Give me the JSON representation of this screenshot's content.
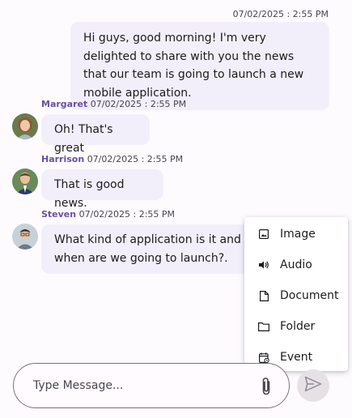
{
  "own_message": {
    "time": "07/02/2025 : 2:55 PM",
    "text": "Hi guys, good morning! I'm very delighted to share with you the news that our team is going to launch a new mobile application."
  },
  "messages": [
    {
      "author": "Margaret",
      "time": "07/02/2025 : 2:55 PM",
      "text": "Oh! That's great",
      "avatar_icon": "avatar-woman"
    },
    {
      "author": "Harrison",
      "time": "07/02/2025 : 2:55 PM",
      "text": "That is good news.",
      "avatar_icon": "avatar-man-suit"
    },
    {
      "author": "Steven",
      "time": "07/02/2025 : 2:55 PM",
      "text": "What kind of application is it and when are we going to launch?.",
      "avatar_icon": "avatar-man-glasses"
    }
  ],
  "attach_menu": [
    {
      "label": "Image",
      "icon": "image-icon"
    },
    {
      "label": "Audio",
      "icon": "audio-icon"
    },
    {
      "label": "Document",
      "icon": "document-icon"
    },
    {
      "label": "Folder",
      "icon": "folder-icon"
    },
    {
      "label": "Event",
      "icon": "event-icon"
    }
  ],
  "composer": {
    "placeholder": "Type Message...",
    "attach_icon": "paperclip-icon",
    "send_icon": "send-icon"
  },
  "colors": {
    "bubble": "#f3effa",
    "author": "#6750a4",
    "send_bg": "#e6e1e5"
  }
}
